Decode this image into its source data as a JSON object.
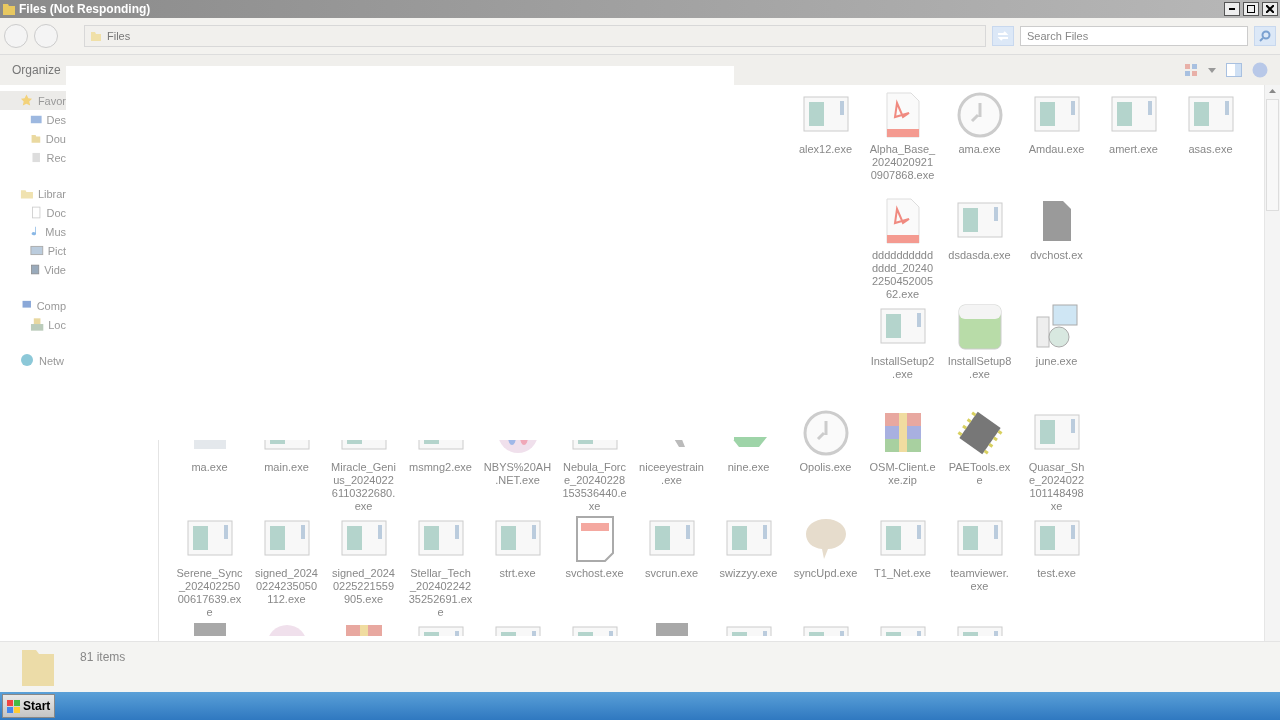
{
  "window": {
    "title": "Files (Not Responding)"
  },
  "address": {
    "path": "Files"
  },
  "search": {
    "placeholder": "Search Files"
  },
  "toolbar": {
    "organize": "Organize"
  },
  "sidebar": {
    "groups": [
      {
        "label": "Favor",
        "kind": "star",
        "selected": true,
        "children": [
          {
            "label": "Des",
            "kind": "desktop",
            "selected": false
          },
          {
            "label": "Dou",
            "kind": "download",
            "selected": false
          },
          {
            "label": "Rec",
            "kind": "recent",
            "selected": false
          }
        ]
      },
      {
        "label": "Librar",
        "kind": "library",
        "selected": false,
        "children": [
          {
            "label": "Doc",
            "kind": "docs",
            "selected": false
          },
          {
            "label": "Mus",
            "kind": "music",
            "selected": false
          },
          {
            "label": "Pict",
            "kind": "pictures",
            "selected": false
          },
          {
            "label": "Vide",
            "kind": "video",
            "selected": false
          }
        ]
      },
      {
        "label": "Comp",
        "kind": "computer",
        "selected": false,
        "children": [
          {
            "label": "Loc",
            "kind": "disk",
            "selected": false
          }
        ]
      },
      {
        "label": "Netw",
        "kind": "network",
        "selected": false
      }
    ]
  },
  "files": {
    "rows": [
      [
        null,
        null,
        null,
        null,
        null,
        null,
        null,
        null,
        {
          "kind": "app",
          "label": [
            "alex12.exe"
          ]
        },
        {
          "kind": "pdf",
          "label": [
            "Alpha_Base_",
            "2024020921",
            "0907868.exe"
          ]
        },
        {
          "kind": "gauge",
          "label": [
            "ama.exe"
          ]
        },
        {
          "kind": "app",
          "label": [
            "Amdau.exe"
          ]
        },
        {
          "kind": "app",
          "label": [
            "amert.exe"
          ]
        },
        {
          "kind": "app",
          "label": [
            "asas.exe"
          ]
        }
      ],
      [
        null,
        null,
        null,
        null,
        null,
        null,
        null,
        null,
        null,
        {
          "kind": "pdf",
          "label": [
            "dddddddddd",
            "dddd_20240",
            "2250452005",
            "62.exe"
          ]
        },
        {
          "kind": "app",
          "label": [
            "dsdasda.exe"
          ]
        },
        {
          "kind": "png",
          "label": [
            "dvchost.ex"
          ]
        },
        null,
        null
      ],
      [
        null,
        null,
        null,
        null,
        null,
        null,
        null,
        null,
        null,
        {
          "kind": "app",
          "label": [
            "InstallSetup2",
            ".exe"
          ]
        },
        {
          "kind": "sheet",
          "label": [
            "InstallSetup8",
            ".exe"
          ]
        },
        {
          "kind": "installer",
          "label": [
            "june.exe"
          ]
        },
        null,
        null
      ],
      [
        {
          "kind": "block",
          "label": [
            "ma.exe"
          ]
        },
        {
          "kind": "app",
          "label": [
            "main.exe"
          ]
        },
        {
          "kind": "app",
          "label": [
            "Miracle_Geni",
            "us_2024022",
            "6110322680.",
            "exe"
          ]
        },
        {
          "kind": "app",
          "label": [
            "msmng2.exe"
          ]
        },
        {
          "kind": "blob",
          "label": [
            "NBYS%20AH",
            ".NET.exe"
          ]
        },
        {
          "kind": "app",
          "label": [
            "Nebula_Forc",
            "e_20240228",
            "153536440.e",
            "xe"
          ]
        },
        {
          "kind": "tool",
          "label": [
            "niceeyestrain",
            ".exe"
          ]
        },
        {
          "kind": "triangle",
          "label": [
            "nine.exe"
          ]
        },
        {
          "kind": "gauge",
          "label": [
            "Opolis.exe"
          ]
        },
        {
          "kind": "archive",
          "label": [
            "OSM-Client.e",
            "xe.zip"
          ]
        },
        {
          "kind": "chip",
          "label": [
            "PAETools.ex",
            "e"
          ]
        },
        {
          "kind": "app",
          "label": [
            "Quasar_Sh",
            "e_2024022",
            "101148498",
            "xe"
          ]
        },
        null,
        null
      ],
      [
        {
          "kind": "app",
          "label": [
            "Serene_Sync",
            "_202402250",
            "00617639.ex",
            "e"
          ]
        },
        {
          "kind": "app",
          "label": [
            "signed_2024",
            "0224235050",
            "112.exe"
          ]
        },
        {
          "kind": "app",
          "label": [
            "signed_2024",
            "0225221559",
            "905.exe"
          ]
        },
        {
          "kind": "app",
          "label": [
            "Stellar_Tech",
            "_202402242",
            "35252691.ex",
            "e"
          ]
        },
        {
          "kind": "app",
          "label": [
            "strt.exe"
          ]
        },
        {
          "kind": "doc",
          "label": [
            "svchost.exe"
          ]
        },
        {
          "kind": "app",
          "label": [
            "svcrun.exe"
          ]
        },
        {
          "kind": "app",
          "label": [
            "swizzyy.exe"
          ]
        },
        {
          "kind": "bubble",
          "label": [
            "syncUpd.exe"
          ]
        },
        {
          "kind": "app",
          "label": [
            "T1_Net.exe"
          ]
        },
        {
          "kind": "app",
          "label": [
            "teamviewer.",
            "exe"
          ]
        },
        {
          "kind": "app",
          "label": [
            "test.exe"
          ]
        },
        null,
        null
      ],
      [
        {
          "kind": "block"
        },
        {
          "kind": "blob"
        },
        {
          "kind": "archive"
        },
        {
          "kind": "app"
        },
        {
          "kind": "app"
        },
        {
          "kind": "app"
        },
        {
          "kind": "block"
        },
        {
          "kind": "app"
        },
        {
          "kind": "app"
        },
        {
          "kind": "app"
        },
        {
          "kind": "app"
        },
        null,
        null,
        null
      ]
    ]
  },
  "details": {
    "count": "81 items"
  },
  "taskbar": {
    "start": "Start"
  }
}
